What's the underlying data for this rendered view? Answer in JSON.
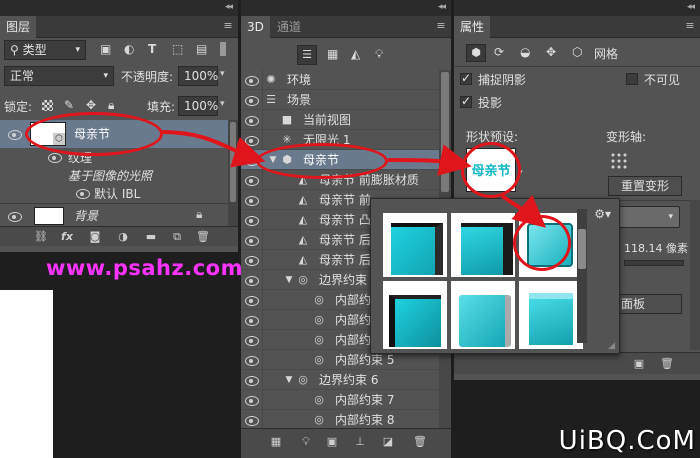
{
  "layers": {
    "tab_label": "图层",
    "filter_kind": "类型",
    "blend_mode": "正常",
    "opacity_label": "不透明度:",
    "opacity_value": "100%",
    "lock_label": "锁定:",
    "fill_label": "填充:",
    "fill_value": "100%",
    "rows": [
      {
        "name": "母亲节"
      },
      {
        "name": "纹理"
      },
      {
        "name": "基于图像的光照"
      },
      {
        "name": "默认 IBL"
      },
      {
        "name": "背景"
      }
    ]
  },
  "watermark": "www.psahz.com",
  "threed": {
    "tab_label": "3D",
    "tab2_label": "通道",
    "rows": [
      {
        "label": "环境"
      },
      {
        "label": "场景"
      },
      {
        "label": "当前视图"
      },
      {
        "label": "无限光 1"
      },
      {
        "label": "母亲节"
      },
      {
        "label": "母亲节 前膨胀材质"
      },
      {
        "label": "母亲节 前"
      },
      {
        "label": "母亲节 凸"
      },
      {
        "label": "母亲节 后"
      },
      {
        "label": "母亲节 后"
      },
      {
        "label": "边界约束"
      },
      {
        "label": "内部约"
      },
      {
        "label": "内部约"
      },
      {
        "label": "内部约"
      },
      {
        "label": "内部约束 5"
      },
      {
        "label": "边界约束 6"
      },
      {
        "label": "内部约束 7"
      },
      {
        "label": "内部约束 8"
      }
    ]
  },
  "properties": {
    "tab_label": "属性",
    "mesh_label": "网格",
    "catch_shadows": "捕捉阴影",
    "invisible": "不可见",
    "cast_shadows": "投影",
    "shape_preset": "形状预设:",
    "deform_axis": "变形轴:",
    "preset_thumb_text": "母亲节",
    "reset_deform": "重置变形",
    "value_readout": "118.14 像素",
    "face_panel": "面板"
  },
  "site_watermark": "UiBQ.CoM",
  "colors": {
    "accent_red": "#e0141b",
    "magenta_text": "#ff33ff",
    "cyan_cube": "#23c4d2",
    "selection": "#6a7a8e"
  }
}
